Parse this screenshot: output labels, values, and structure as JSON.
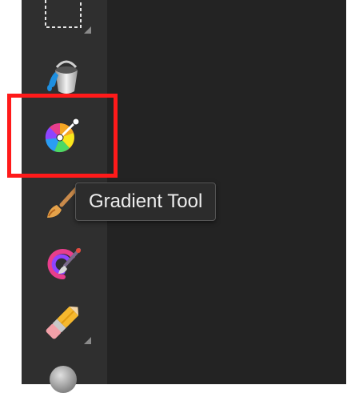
{
  "tooltip": {
    "text": "Gradient Tool"
  },
  "tools": [
    {
      "name": "marquee-selection-tool",
      "icon": "marquee-icon",
      "has_submenu": true
    },
    {
      "name": "fill-tool",
      "icon": "paint-bucket-icon",
      "has_submenu": false
    },
    {
      "name": "gradient-tool",
      "icon": "gradient-icon",
      "has_submenu": false,
      "highlighted": true
    },
    {
      "name": "paint-brush-tool",
      "icon": "paint-brush-icon",
      "has_submenu": true
    },
    {
      "name": "pixel-brush-tool",
      "icon": "color-brush-icon",
      "has_submenu": false
    },
    {
      "name": "eraser-tool",
      "icon": "eraser-icon",
      "has_submenu": true
    },
    {
      "name": "shape-tool",
      "icon": "circle-shape-icon",
      "has_submenu": false
    }
  ],
  "colors": {
    "toolbar_bg": "#2f2f2f",
    "canvas_bg": "#232323",
    "highlight": "#ff1a1a",
    "tooltip_bg": "#2c2c2c",
    "tooltip_text": "#ededed"
  }
}
